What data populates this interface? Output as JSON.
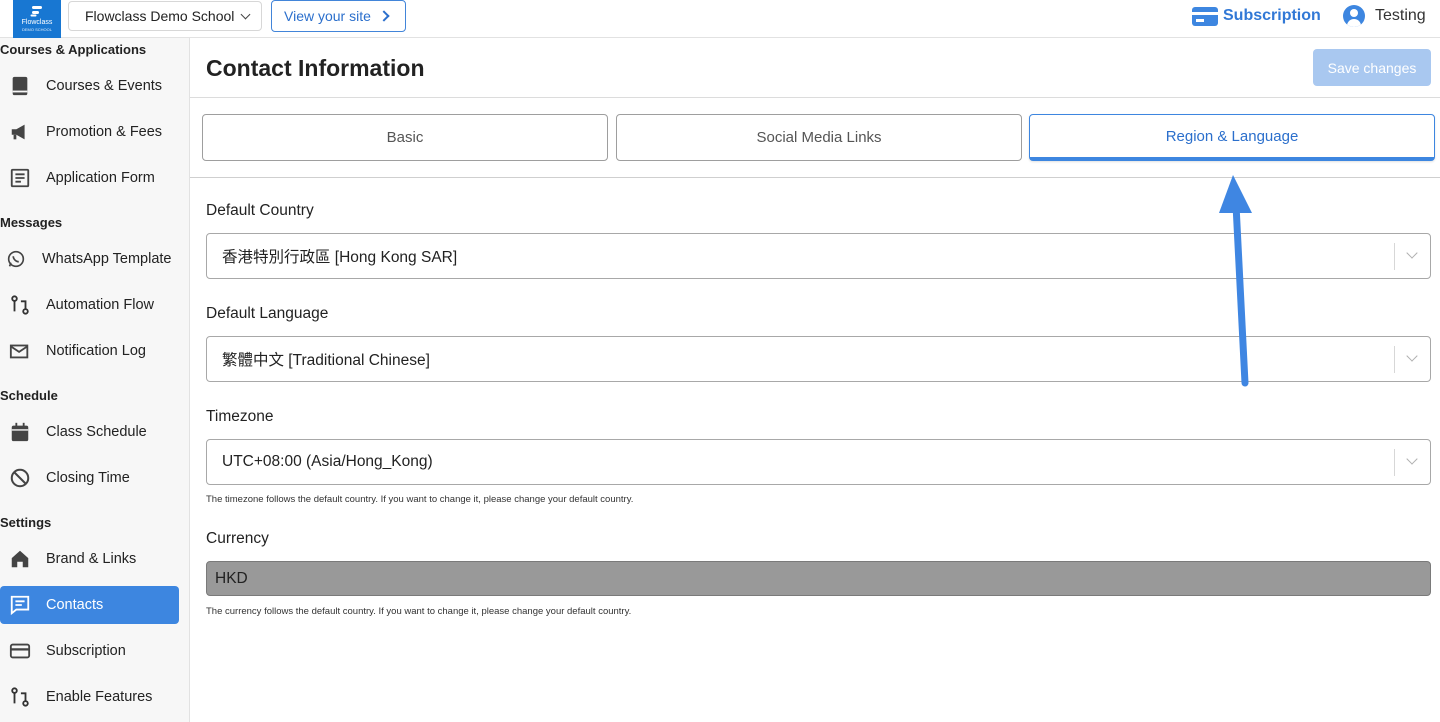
{
  "topbar": {
    "logo_text": "Flowclass",
    "logo_subtext": "DEMO SCHOOL",
    "school_name": "Flowclass Demo School",
    "view_site_label": "View your site",
    "subscription_label": "Subscription",
    "user_name": "Testing"
  },
  "sidebar": {
    "sections": [
      {
        "title": "Courses & Applications"
      },
      {
        "title": "Messages"
      },
      {
        "title": "Schedule"
      },
      {
        "title": "Settings"
      }
    ],
    "items": [
      {
        "label": "Courses & Events",
        "icon": "book-icon"
      },
      {
        "label": "Promotion & Fees",
        "icon": "megaphone-icon"
      },
      {
        "label": "Application Form",
        "icon": "form-icon"
      },
      {
        "label": "WhatsApp Template",
        "icon": "whatsapp-icon"
      },
      {
        "label": "Automation Flow",
        "icon": "flow-icon"
      },
      {
        "label": "Notification Log",
        "icon": "mail-icon"
      },
      {
        "label": "Class Schedule",
        "icon": "calendar-icon"
      },
      {
        "label": "Closing Time",
        "icon": "ban-icon"
      },
      {
        "label": "Brand & Links",
        "icon": "home-icon"
      },
      {
        "label": "Contacts",
        "icon": "chat-icon",
        "active": true
      },
      {
        "label": "Subscription",
        "icon": "card-icon"
      },
      {
        "label": "Enable Features",
        "icon": "flow-icon"
      }
    ]
  },
  "header": {
    "title": "Contact Information",
    "save_label": "Save changes"
  },
  "tabs": [
    {
      "label": "Basic"
    },
    {
      "label": "Social Media Links"
    },
    {
      "label": "Region & Language",
      "active": true
    }
  ],
  "form": {
    "country": {
      "label": "Default Country",
      "value": "香港特別行政區 [Hong Kong SAR]"
    },
    "language": {
      "label": "Default Language",
      "value": "繁體中文 [Traditional Chinese]"
    },
    "timezone": {
      "label": "Timezone",
      "value": "UTC+08:00 (Asia/Hong_Kong)",
      "note": "The timezone follows the default country. If you want to change it, please change your default country."
    },
    "currency": {
      "label": "Currency",
      "value": "HKD",
      "note": "The currency follows the default country. If you want to change it, please change your default country."
    }
  },
  "colors": {
    "accent": "#3d86e0",
    "save_disabled": "#a9c8f0",
    "currency_bg": "#999999",
    "annotation_arrow": "#3f86e2"
  }
}
